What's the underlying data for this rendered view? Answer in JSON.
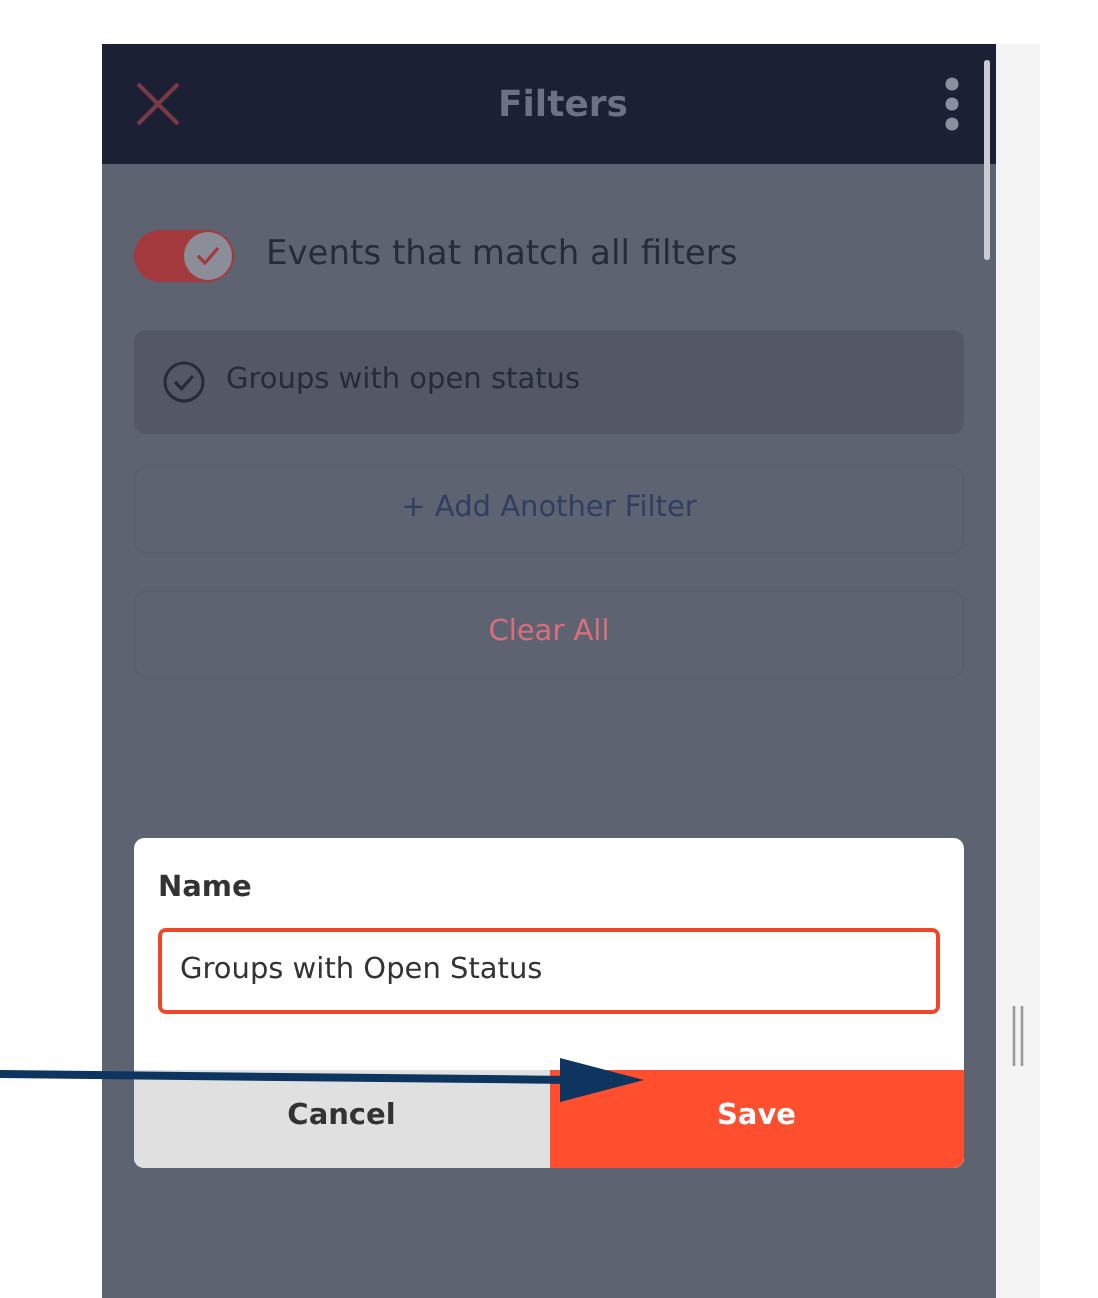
{
  "header": {
    "title": "Filters"
  },
  "match_toggle": {
    "label": "Events that match all filters",
    "on": true
  },
  "filters": [
    {
      "label": "Groups with open status",
      "checked": true
    }
  ],
  "add_filter": "+ Add Another Filter",
  "clear_all": "Clear All",
  "dialog": {
    "label": "Name",
    "value": "Groups with Open Status",
    "buttons": [
      {
        "label": "Cancel",
        "kind": "secondary"
      },
      {
        "label": "Save",
        "kind": "primary"
      }
    ]
  }
}
